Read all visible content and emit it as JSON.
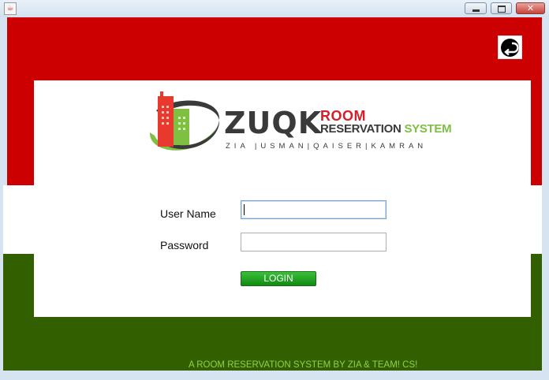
{
  "window": {
    "app_icon": "java-cup-icon",
    "min_glyph": "",
    "max_glyph": "",
    "close_glyph": "✕"
  },
  "header": {
    "logout_icon": "logout-icon"
  },
  "logo": {
    "brand": "ZUQK",
    "line1": "ROOM",
    "line2_main": "RESERVATION",
    "line2_accent": "SYSTEM",
    "team": "ZIA |USMAN|QAISER|KAMRAN",
    "colors": {
      "red": "#e8392f",
      "green": "#7fc043",
      "dark": "#3a3a3a"
    }
  },
  "form": {
    "username_label": "User Name",
    "username_value": "",
    "password_label": "Password",
    "password_value": "",
    "login_label": "LOGIN"
  },
  "footer": {
    "text": "A ROOM RESERVATION SYSTEM BY ZIA & TEAM! CS!"
  },
  "colors": {
    "top_band": "#cc0000",
    "bottom_band": "#326000",
    "login_button": "#1c9a1c",
    "footer_text": "#8fd14a"
  }
}
